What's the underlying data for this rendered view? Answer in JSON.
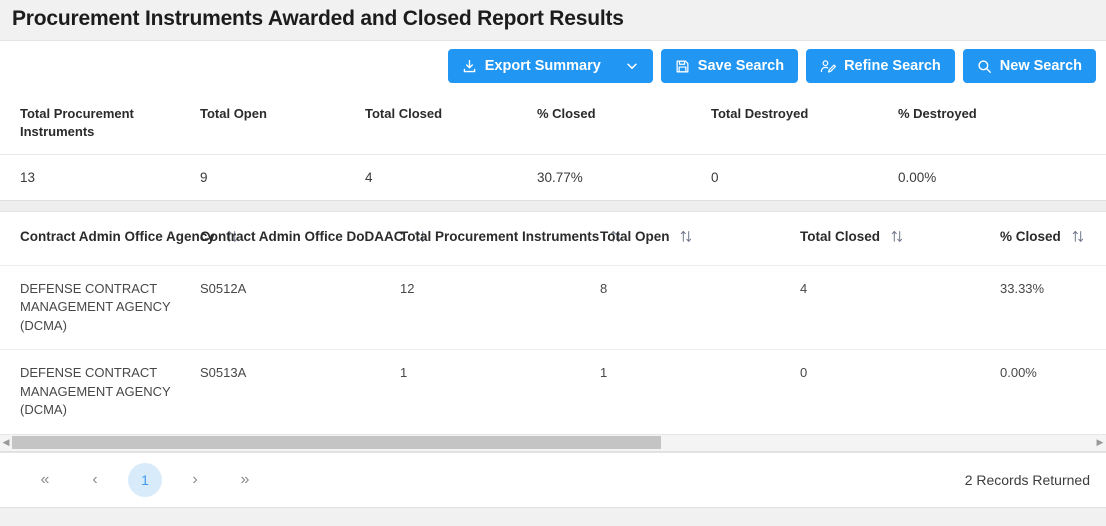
{
  "header": {
    "title": "Procurement Instruments Awarded and Closed Report Results"
  },
  "toolbar": {
    "export_label": "Export Summary",
    "export_icon": "download-icon",
    "export_chevron_icon": "chevron-down-icon",
    "save_label": "Save Search",
    "save_icon": "save-disk-icon",
    "refine_label": "Refine Search",
    "refine_icon": "user-edit-icon",
    "new_label": "New Search",
    "new_icon": "search-icon",
    "button_color": "#2196f3"
  },
  "summary": {
    "columns": [
      "Total Procurement Instruments",
      "Total Open",
      "Total Closed",
      "% Closed",
      "Total Destroyed",
      "% Destroyed"
    ],
    "values": [
      "13",
      "9",
      "4",
      "30.77%",
      "0",
      "0.00%"
    ]
  },
  "table": {
    "columns": [
      {
        "label": "Contract Admin Office Agency",
        "sort_icon": "sort-updown-icon"
      },
      {
        "label": "Contract Admin Office DoDAAC",
        "sort_icon": "sort-updown-icon"
      },
      {
        "label": "Total Procurement Instruments",
        "sort_icon": "sort-updown-icon"
      },
      {
        "label": "Total Open",
        "sort_icon": "sort-updown-icon"
      },
      {
        "label": "Total Closed",
        "sort_icon": "sort-updown-icon"
      },
      {
        "label": "% Closed",
        "sort_icon": "sort-updown-icon"
      }
    ],
    "rows": [
      {
        "agency": "DEFENSE CONTRACT MANAGEMENT AGENCY (DCMA)",
        "dodaac": "S0512A",
        "total": "12",
        "open": "8",
        "closed": "4",
        "pct_closed": "33.33%"
      },
      {
        "agency": "DEFENSE CONTRACT MANAGEMENT AGENCY (DCMA)",
        "dodaac": "S0513A",
        "total": "1",
        "open": "1",
        "closed": "0",
        "pct_closed": "0.00%"
      }
    ]
  },
  "scrollbar": {
    "left_arrow_icon": "triangle-left-icon",
    "right_arrow_icon": "triangle-right-icon",
    "thumb_width_pct": "60%"
  },
  "pager": {
    "first_label": "«",
    "prev_label": "‹",
    "current_page": "1",
    "next_label": "›",
    "last_label": "»",
    "records_text": "2 Records Returned",
    "active_color": "#3f9bf0"
  }
}
